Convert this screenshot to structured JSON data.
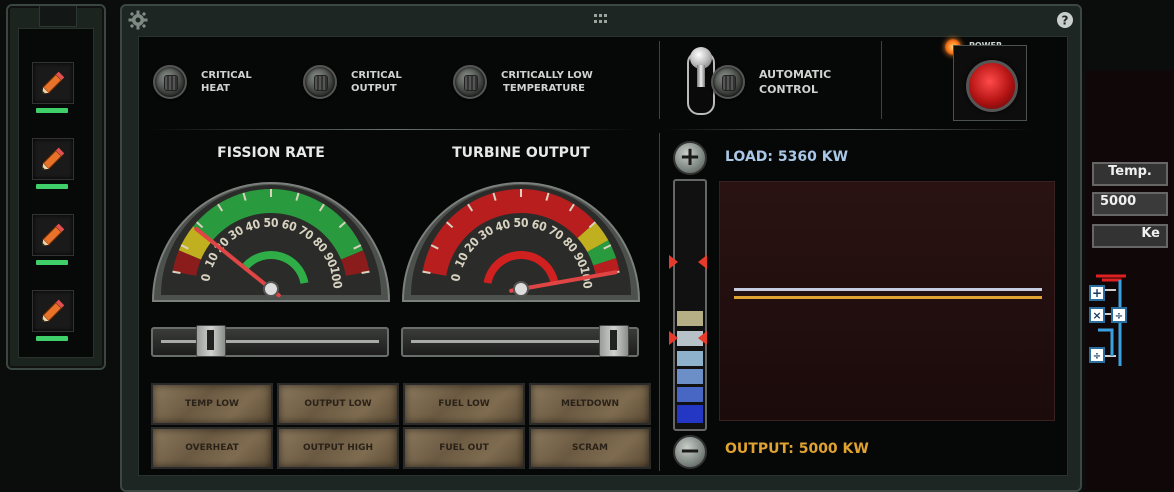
{
  "toolbar": {
    "tools": [
      {
        "icon": "pencil-icon"
      },
      {
        "icon": "pencil-icon"
      },
      {
        "icon": "pencil-icon"
      },
      {
        "icon": "pencil-icon"
      }
    ]
  },
  "header": {
    "settings_icon": "gear-icon",
    "drag_icon": "grid-dots-icon",
    "help_icon": "question-icon"
  },
  "alarms": [
    {
      "line1": "CRITICAL",
      "line2": "HEAT"
    },
    {
      "line1": "CRITICAL",
      "line2": "OUTPUT"
    },
    {
      "line1": "CRITICALLY LOW",
      "line2": "TEMPERATURE"
    }
  ],
  "automatic_control": {
    "line1": "AUTOMATIC",
    "line2": "CONTROL"
  },
  "power": {
    "label": "POWER"
  },
  "fission_gauge": {
    "title": "FISSION RATE",
    "ticks": [
      "0",
      "10",
      "20",
      "30",
      "40",
      "50",
      "60",
      "70",
      "80",
      "90",
      "100"
    ],
    "value": 18
  },
  "turbine_gauge": {
    "title": "TURBINE OUTPUT",
    "ticks": [
      "0",
      "10",
      "20",
      "30",
      "40",
      "50",
      "60",
      "70",
      "80",
      "90",
      "100"
    ],
    "value": 100
  },
  "fission_slider": {
    "value": 0.18
  },
  "turbine_slider": {
    "value": 1.0
  },
  "warnings": [
    [
      "TEMP LOW",
      "OUTPUT LOW",
      "FUEL LOW",
      "MELTDOWN"
    ],
    [
      "OVERHEAT",
      "OUTPUT HIGH",
      "FUEL OUT",
      "SCRAM"
    ]
  ],
  "load": {
    "label": "LOAD: 5360 KW"
  },
  "output": {
    "label": "OUTPUT: 5000 KW"
  },
  "side_panel": {
    "temp_label": "Temp.",
    "value": "5000",
    "unit": "Ke"
  },
  "colors": {
    "accent_green": "#3fd06a",
    "load_line": "#c7cde0",
    "output_line": "#e0a230",
    "power_red": "#d42020"
  }
}
